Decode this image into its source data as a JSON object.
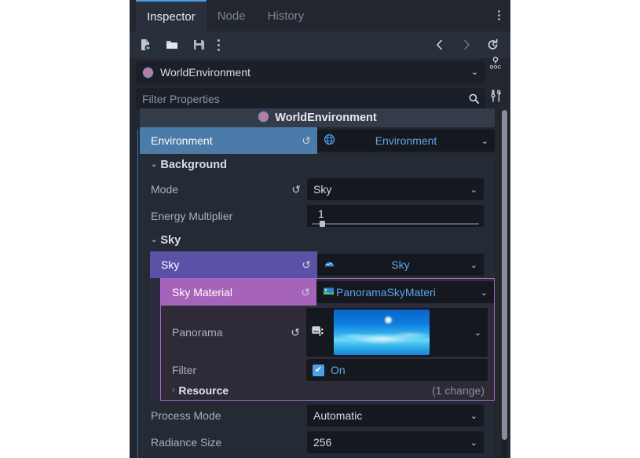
{
  "tabs": [
    {
      "label": "Inspector",
      "active": true
    },
    {
      "label": "Node",
      "active": false
    },
    {
      "label": "History",
      "active": false
    }
  ],
  "toolbar": {
    "new_resource": "new-resource",
    "open_resource": "open-resource",
    "save_resource": "save-resource",
    "more_options": "more-options",
    "back": "‹",
    "forward": "›",
    "history": "history"
  },
  "side": {
    "open_docs": "open-documentation",
    "object_tools": "object-tools"
  },
  "node_selector": {
    "name": "WorldEnvironment",
    "chevron": "⌄"
  },
  "search": {
    "placeholder": "Filter Properties",
    "icon": "search-icon"
  },
  "object_header": {
    "title": "WorldEnvironment"
  },
  "properties": {
    "environment": {
      "label": "Environment",
      "value": "Environment",
      "chevron": "⌄",
      "revert": "↺"
    },
    "background_section": {
      "label": "Background",
      "arrow": "⌄"
    },
    "mode": {
      "label": "Mode",
      "value": "Sky",
      "chevron": "⌄",
      "revert": "↺"
    },
    "energy_multiplier": {
      "label": "Energy Multiplier",
      "value": "1"
    },
    "sky_section": {
      "label": "Sky",
      "arrow": "⌄"
    },
    "sky": {
      "label": "Sky",
      "value": "Sky",
      "chevron": "⌄",
      "revert": "↺"
    },
    "sky_material": {
      "label": "Sky Material",
      "value": "PanoramaSkyMateri",
      "chevron": "⌄",
      "revert": "↺"
    },
    "panorama": {
      "label": "Panorama",
      "chevron": "⌄",
      "revert": "↺",
      "texture_icon": "texture-icon"
    },
    "filter": {
      "label": "Filter",
      "value": "On",
      "checked": true,
      "check_glyph": "✔"
    },
    "resource": {
      "label": "Resource",
      "arrow": "›",
      "changes": "(1 change)"
    },
    "process_mode": {
      "label": "Process Mode",
      "value": "Automatic",
      "chevron": "⌄"
    },
    "radiance_size": {
      "label": "Radiance Size",
      "value": "256",
      "chevron": "⌄"
    }
  },
  "colors": {
    "accent": "#4d9ee8",
    "panel_bg": "#21262f",
    "field_bg": "#15181f",
    "level_environment": "#4a7ba9",
    "level_sky": "#5b52a8",
    "level_material": "#a564b9"
  }
}
